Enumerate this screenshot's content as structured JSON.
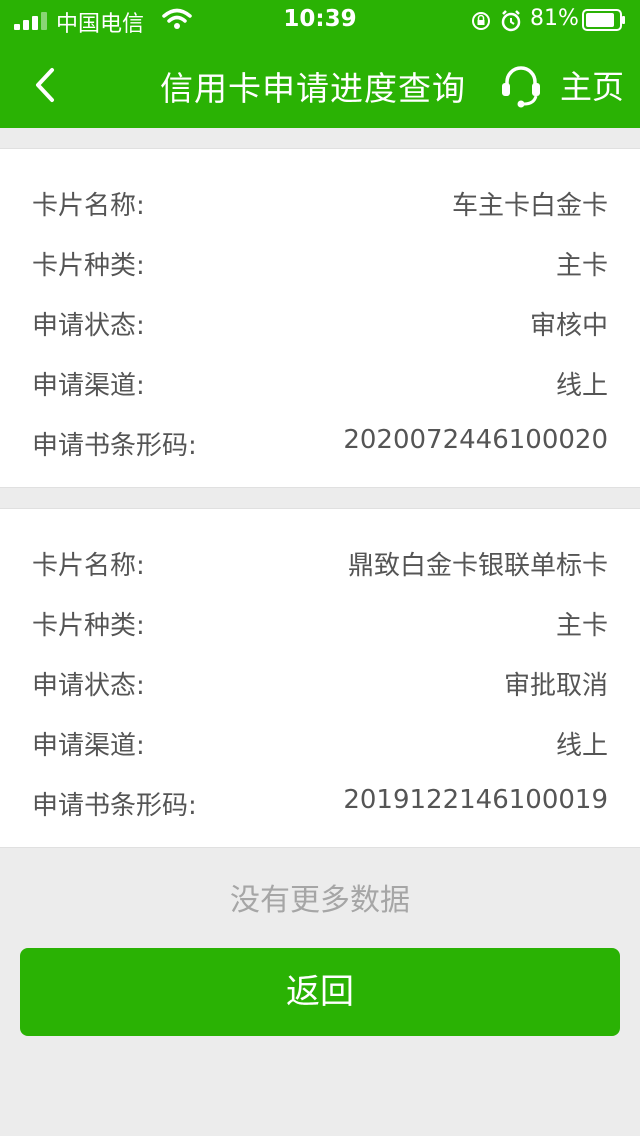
{
  "status_bar": {
    "carrier": "中国电信",
    "time": "10:39",
    "battery": "81%"
  },
  "nav": {
    "title": "信用卡申请进度查询",
    "home_label": "主页"
  },
  "cards": [
    {
      "rows": [
        {
          "label": "卡片名称:",
          "value": "车主卡白金卡"
        },
        {
          "label": "卡片种类:",
          "value": "主卡"
        },
        {
          "label": "申请状态:",
          "value": "审核中"
        },
        {
          "label": "申请渠道:",
          "value": "线上"
        },
        {
          "label": "申请书条形码:",
          "value": "2020072446100020"
        }
      ]
    },
    {
      "rows": [
        {
          "label": "卡片名称:",
          "value": "鼎致白金卡银联单标卡"
        },
        {
          "label": "卡片种类:",
          "value": "主卡"
        },
        {
          "label": "申请状态:",
          "value": "审批取消"
        },
        {
          "label": "申请渠道:",
          "value": "线上"
        },
        {
          "label": "申请书条形码:",
          "value": "2019122146100019"
        }
      ]
    }
  ],
  "footer": {
    "no_more": "没有更多数据",
    "back_button": "返回"
  },
  "colors": {
    "brand_green": "#2ab204",
    "background": "#ececec"
  }
}
